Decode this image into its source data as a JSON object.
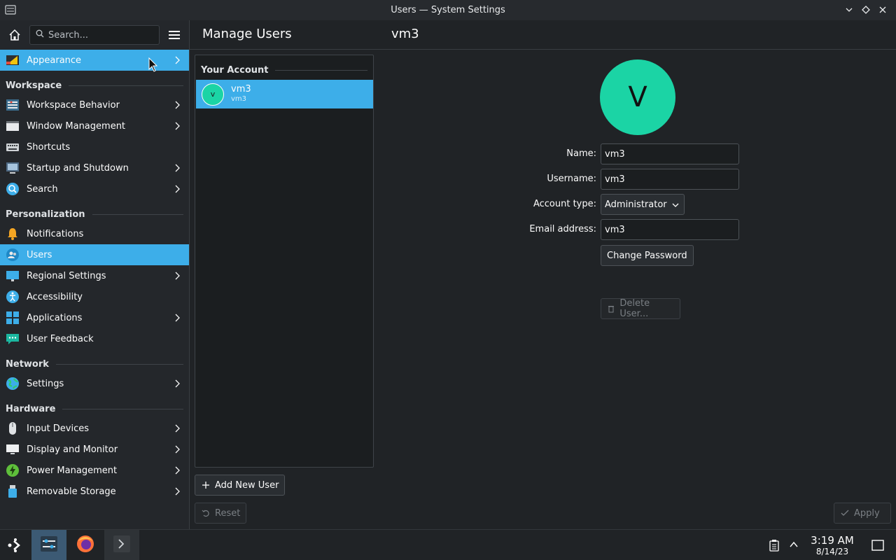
{
  "window": {
    "title": "Users — System Settings"
  },
  "sidebar": {
    "search_placeholder": "Search...",
    "top_item": {
      "label": "Appearance",
      "icon": "appearance-icon"
    },
    "sections": {
      "workspace": "Workspace",
      "personalization": "Personalization",
      "network": "Network",
      "hardware": "Hardware"
    },
    "items": {
      "workspace_behavior": "Workspace Behavior",
      "window_management": "Window Management",
      "shortcuts": "Shortcuts",
      "startup_shutdown": "Startup and Shutdown",
      "search": "Search",
      "notifications": "Notifications",
      "users": "Users",
      "regional_settings": "Regional Settings",
      "accessibility": "Accessibility",
      "applications": "Applications",
      "user_feedback": "User Feedback",
      "settings": "Settings",
      "input_devices": "Input Devices",
      "display_monitor": "Display and Monitor",
      "power_management": "Power Management",
      "removable_storage": "Removable Storage"
    }
  },
  "header": {
    "page_title": "Manage Users",
    "user_title": "vm3"
  },
  "accounts": {
    "section_label": "Your Account",
    "list": [
      {
        "initial": "v",
        "name": "vm3",
        "username": "vm3"
      }
    ],
    "add_button": "Add New User"
  },
  "details": {
    "avatar_initial": "V",
    "name_label": "Name:",
    "name_value": "vm3",
    "username_label": "Username:",
    "username_value": "vm3",
    "account_type_label": "Account type:",
    "account_type_value": "Administrator",
    "email_label": "Email address:",
    "email_value": "vm3",
    "change_password": "Change Password",
    "delete_user": "Delete User..."
  },
  "footer": {
    "reset": "Reset",
    "apply": "Apply"
  },
  "taskbar": {
    "time": "3:19 AM",
    "date": "8/14/23"
  },
  "colors": {
    "accent": "#3daee9",
    "avatar": "#1bd4a5",
    "background": "#202326"
  }
}
